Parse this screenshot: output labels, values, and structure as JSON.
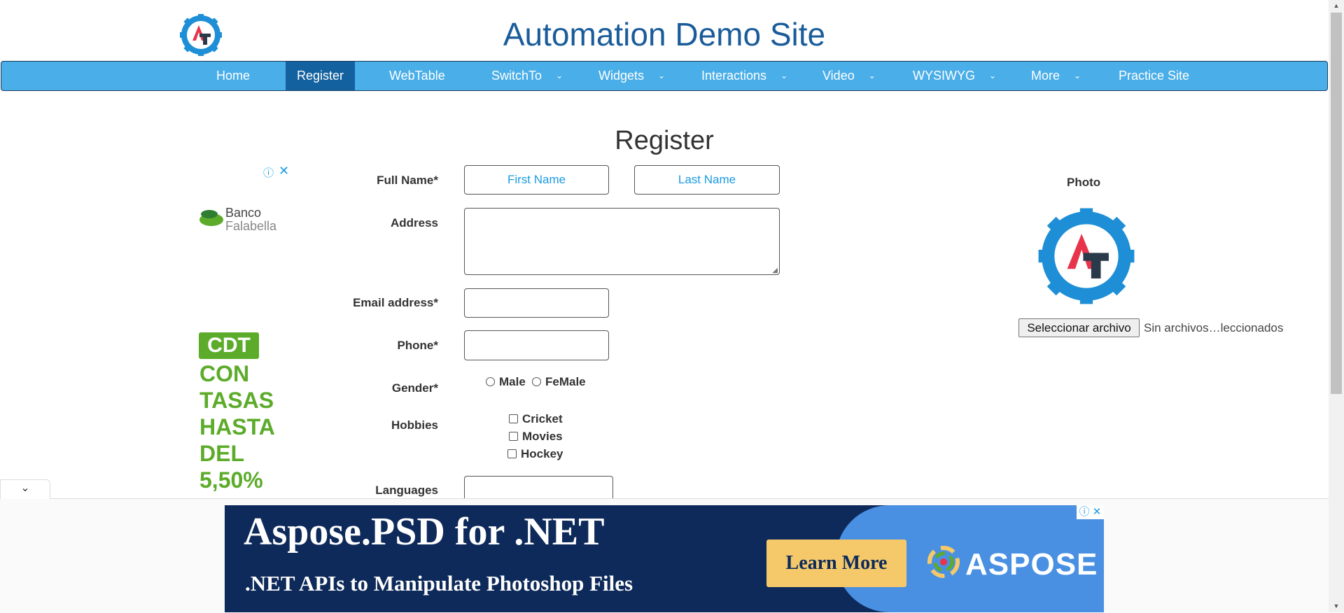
{
  "header": {
    "title": "Automation Demo Site",
    "logo": "AT"
  },
  "nav": {
    "items": [
      {
        "label": "Home"
      },
      {
        "label": "Register"
      },
      {
        "label": "WebTable"
      },
      {
        "label": "SwitchTo"
      },
      {
        "label": "Widgets"
      },
      {
        "label": "Interactions"
      },
      {
        "label": "Video"
      },
      {
        "label": "WYSIWYG"
      },
      {
        "label": "More"
      },
      {
        "label": "Practice Site"
      }
    ],
    "active": "Register",
    "caret": "⌄"
  },
  "form": {
    "title": "Register",
    "full_name_label": "Full Name*",
    "first_name_placeholder": "First Name",
    "last_name_placeholder": "Last Name",
    "address_label": "Address",
    "email_label": "Email address*",
    "phone_label": "Phone*",
    "gender_label": "Gender*",
    "gender_options": [
      "Male",
      "FeMale"
    ],
    "hobbies_label": "Hobbies",
    "hobbies": [
      "Cricket",
      "Movies",
      "Hockey"
    ],
    "languages_label": "Languages"
  },
  "photo": {
    "label": "Photo",
    "file_button": "Seleccionar archivo",
    "file_status": "Sin archivos…leccionados",
    "logo": "AT"
  },
  "left_ad": {
    "info_icon": "ⓘ",
    "close_icon": "✕",
    "bank_line1": "Banco",
    "bank_line2": "Falabella",
    "badge": "CDT",
    "lines": [
      "CON",
      "TASAS",
      "HASTA",
      "DEL",
      "5,50%"
    ]
  },
  "bottom_ad": {
    "collapse_icon": "⌄",
    "headline": "Aspose.PSD for .NET",
    "subline": ".NET APIs to Manipulate Photoshop Files",
    "cta": "Learn More",
    "brand": "ASPOSE",
    "info_icon": "ⓘ",
    "close_icon": "✕"
  },
  "colors": {
    "nav_bg": "#4aaee8",
    "nav_active": "#1461a0",
    "title": "#1a5c9a",
    "cdt_green": "#5cab2a",
    "ad_navy": "#0e2a5a",
    "ad_cta": "#f5c96a"
  }
}
